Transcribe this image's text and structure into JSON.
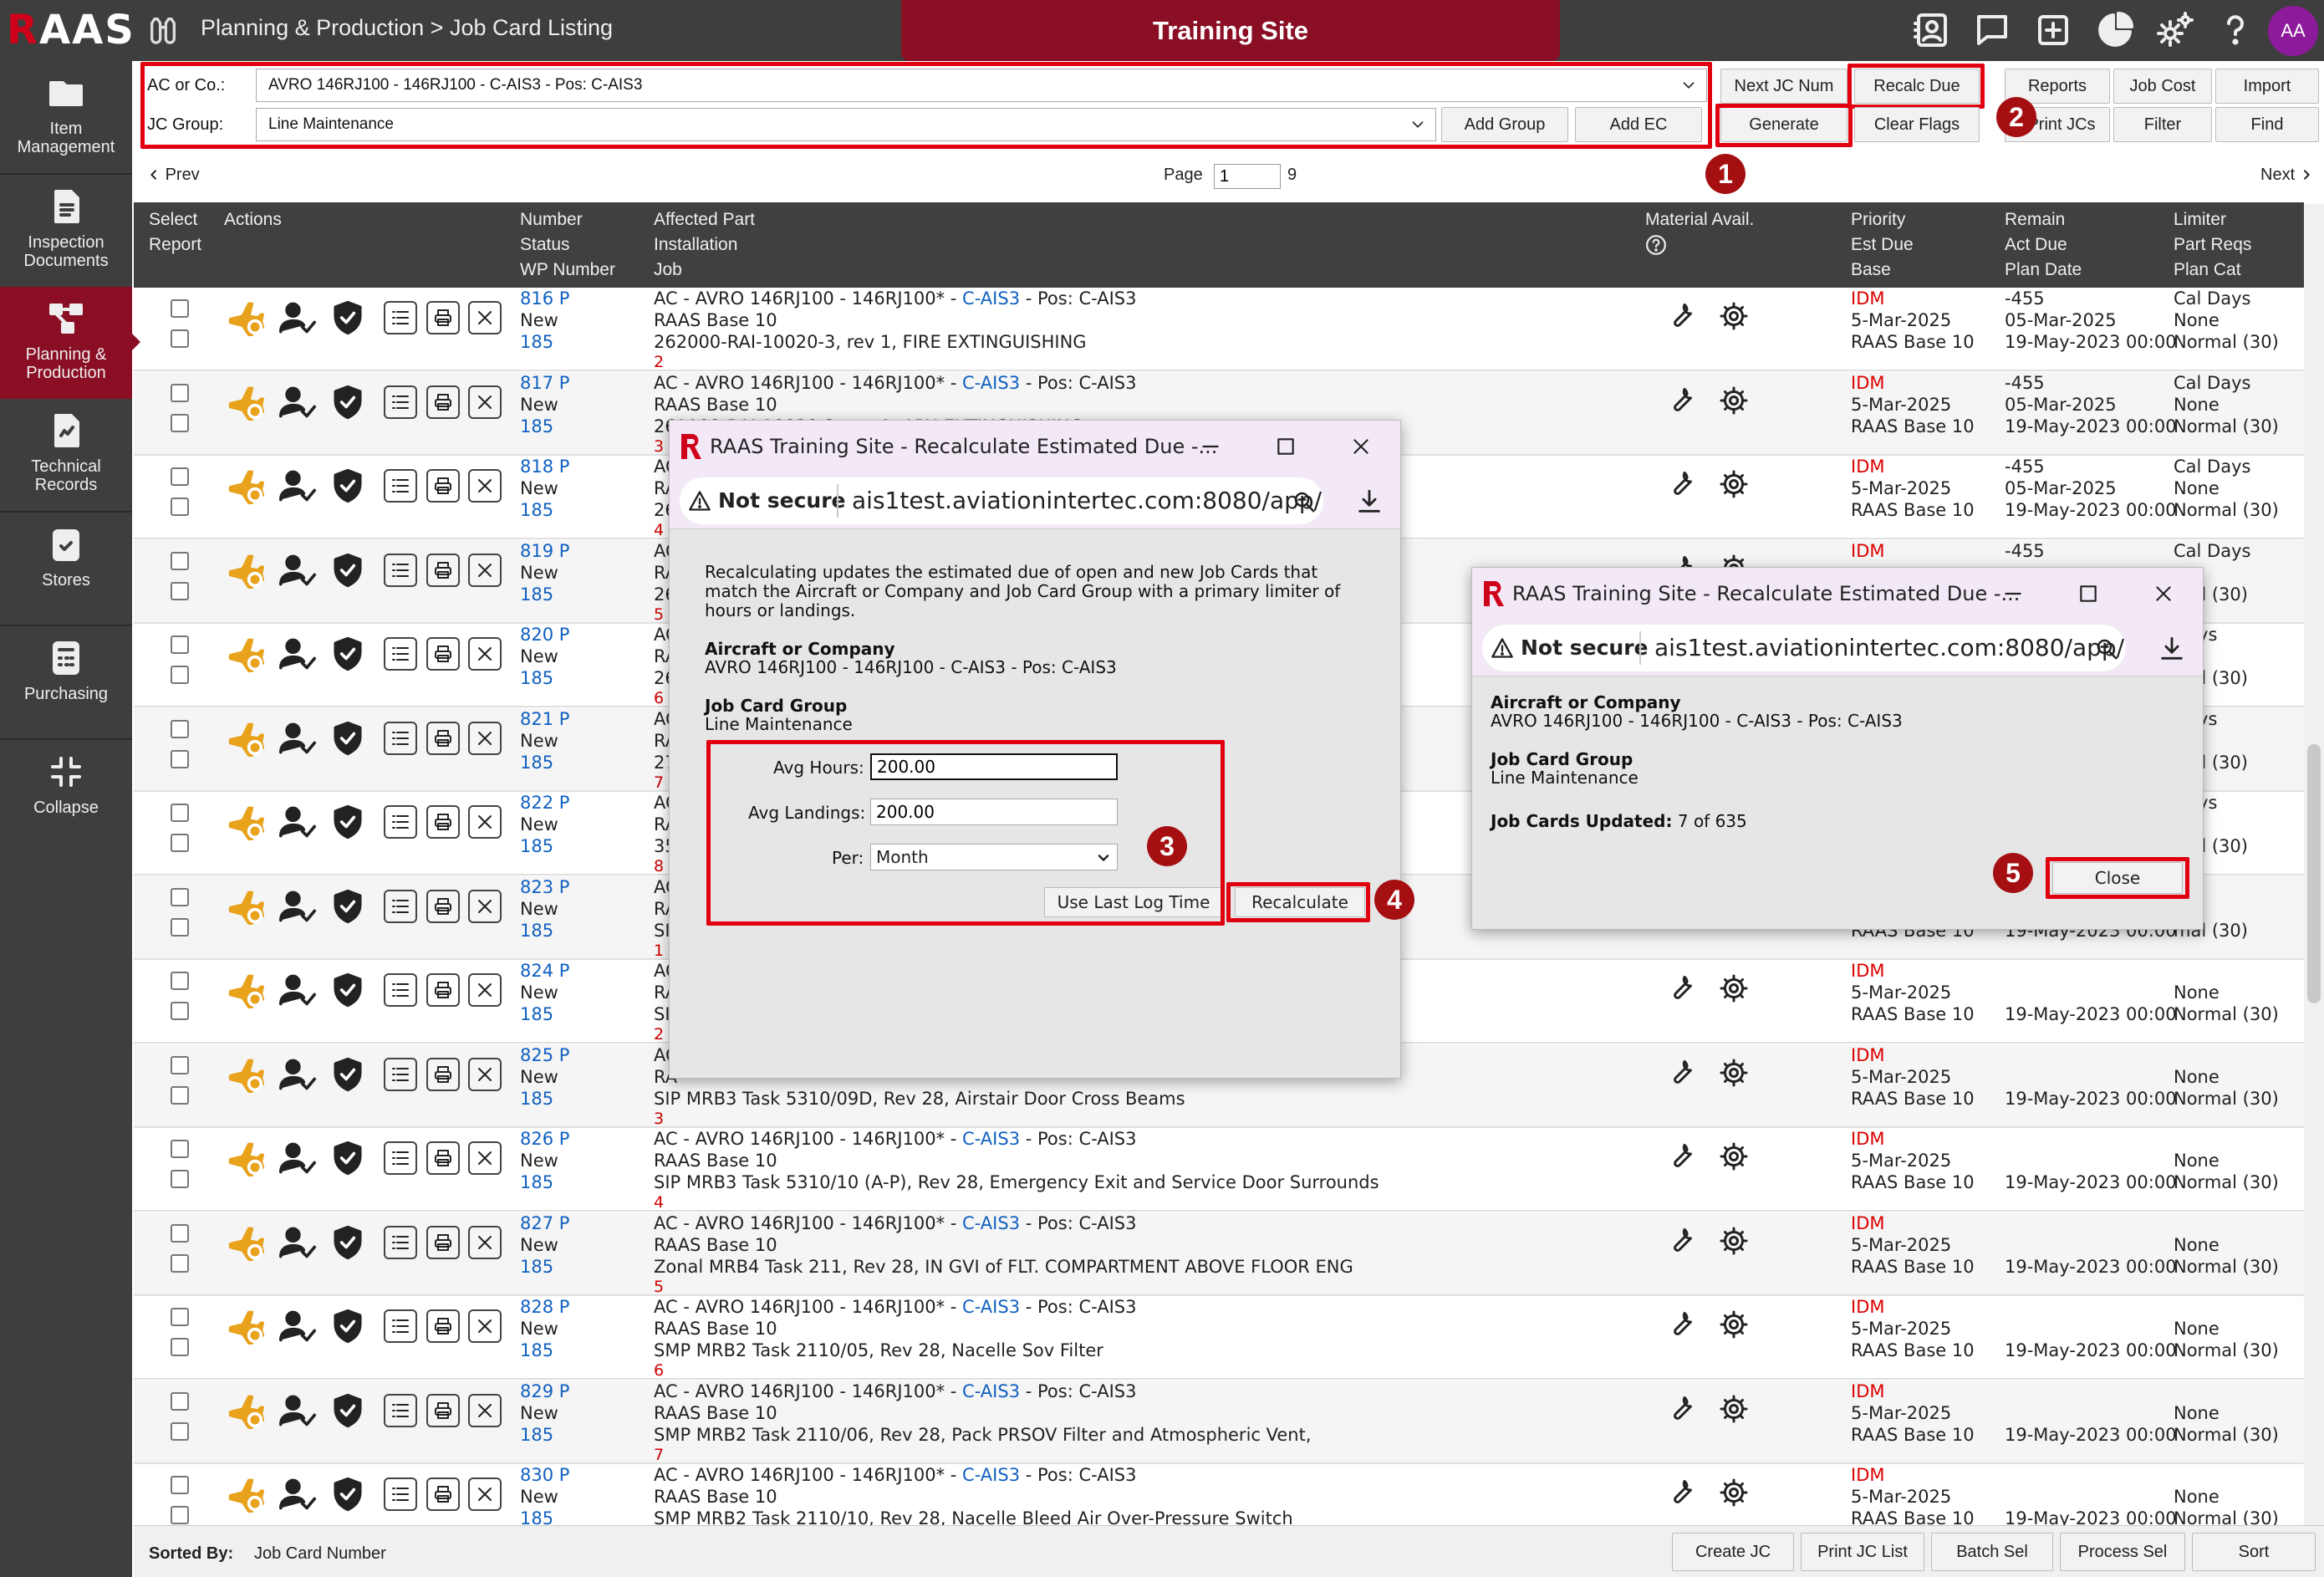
{
  "app": {
    "logo_r": "R",
    "logo_rest": "AAS",
    "breadcrumb": "Planning & Production > Job Card Listing",
    "site_label": "Training Site",
    "user_initials": "AA"
  },
  "toolbar_icons": [
    "contact-card-icon",
    "chat-icon",
    "add-square-icon",
    "pie-chart-icon",
    "gears-icon",
    "help-icon"
  ],
  "sidebar": {
    "items": [
      {
        "label1": "Item",
        "label2": "Management"
      },
      {
        "label1": "Inspection",
        "label2": "Documents"
      },
      {
        "label1": "Planning &",
        "label2": "Production"
      },
      {
        "label1": "Technical",
        "label2": "Records"
      },
      {
        "label1": "Stores",
        "label2": ""
      },
      {
        "label1": "Purchasing",
        "label2": ""
      },
      {
        "label1": "Collapse",
        "label2": ""
      }
    ]
  },
  "filters": {
    "ac_label": "AC or Co.:",
    "ac_value": "AVRO 146RJ100 - 146RJ100 - C-AIS3 - Pos: C-AIS3",
    "jc_label": "JC Group:",
    "jc_value": "Line Maintenance"
  },
  "buttons": {
    "add_group": "Add Group",
    "add_ec": "Add EC",
    "next_jc_num": "Next JC Num",
    "recalc_due": "Recalc Due",
    "generate": "Generate",
    "clear_flags": "Clear Flags",
    "reports": "Reports",
    "job_cost": "Job Cost",
    "import": "Import",
    "print_jcs": "Print JCs",
    "filter": "Filter",
    "find": "Find"
  },
  "pager": {
    "prev": "Prev",
    "next": "Next",
    "page_label": "Page",
    "page_value": "1",
    "total": "9"
  },
  "columns": {
    "select": "Select",
    "report": "Report",
    "actions": "Actions",
    "number": "Number",
    "status": "Status",
    "wp_number": "WP Number",
    "affected_part": "Affected Part",
    "installation": "Installation",
    "job": "Job",
    "material": "Material Avail.",
    "priority": "Priority",
    "est_due": "Est Due",
    "base": "Base",
    "remain": "Remain",
    "act_due": "Act Due",
    "plan_date": "Plan Date",
    "limiter": "Limiter",
    "part_reqs": "Part Reqs",
    "plan_cat": "Plan Cat"
  },
  "rows": [
    {
      "number": "816 P",
      "status": "New",
      "wp": "185",
      "part_prefix": "AC - AVRO 146RJ100 - 146RJ100* - ",
      "part_link": "C-AIS3",
      "part_suffix": " - Pos: C-AIS3",
      "install": "RAAS Base 10",
      "job": "262000-RAI-10020-3, rev 1, FIRE EXTINGUISHING",
      "seq": "2",
      "priority": "IDM",
      "est_due": "5-Mar-2025",
      "base": "RAAS Base 10",
      "remain": "-455",
      "act_due": "05-Mar-2025",
      "plan_date": "19-May-2023 00:00",
      "limiter": "Cal Days",
      "part_reqs": "None",
      "plan_cat": "Normal (30)"
    },
    {
      "number": "817 P",
      "status": "New",
      "wp": "185",
      "part_prefix": "AC - AVRO 146RJ100 - 146RJ100* - ",
      "part_link": "C-AIS3",
      "part_suffix": " - Pos: C-AIS3",
      "install": "RAAS Base 10",
      "job": "261100-RAI-10020-3, rev 1, APU EXTINGUISHING",
      "seq": "3",
      "priority": "IDM",
      "est_due": "5-Mar-2025",
      "base": "RAAS Base 10",
      "remain": "-455",
      "act_due": "05-Mar-2025",
      "plan_date": "19-May-2023 00:00",
      "limiter": "Cal Days",
      "part_reqs": "None",
      "plan_cat": "Normal (30)"
    },
    {
      "number": "818 P",
      "status": "New",
      "wp": "185",
      "part_prefix": "AC",
      "part_link": "",
      "part_suffix": "",
      "install": "RA",
      "job": "26",
      "seq": "4",
      "priority": "IDM",
      "est_due": "5-Mar-2025",
      "base": "RAAS Base 10",
      "remain": "-455",
      "act_due": "05-Mar-2025",
      "plan_date": "19-May-2023 00:00",
      "limiter": "Cal Days",
      "part_reqs": "None",
      "plan_cat": "Normal (30)"
    },
    {
      "number": "819 P",
      "status": "New",
      "wp": "185",
      "part_prefix": "AC",
      "part_link": "",
      "part_suffix": "",
      "install": "RA",
      "job": "26",
      "seq": "5",
      "priority": "IDM",
      "est_due": "",
      "base": "",
      "remain": "-455",
      "act_due": "",
      "plan_date": "",
      "limiter": "Cal Days",
      "part_reqs": "",
      "plan_cat": "mal (30)"
    },
    {
      "number": "820 P",
      "status": "New",
      "wp": "185",
      "part_prefix": "AC",
      "part_link": "",
      "part_suffix": "",
      "install": "RA",
      "job": "26",
      "seq": "6",
      "priority": "",
      "est_due": "",
      "base": "",
      "remain": "",
      "act_due": "",
      "plan_date": "",
      "limiter": "Days",
      "part_reqs": "e",
      "plan_cat": "mal (30)"
    },
    {
      "number": "821 P",
      "status": "New",
      "wp": "185",
      "part_prefix": "AC",
      "part_link": "",
      "part_suffix": "",
      "install": "RA",
      "job": "27",
      "seq": "7",
      "priority": "",
      "est_due": "",
      "base": "",
      "remain": "",
      "act_due": "",
      "plan_date": "",
      "limiter": "Days",
      "part_reqs": "e",
      "plan_cat": "mal (30)"
    },
    {
      "number": "822 P",
      "status": "New",
      "wp": "185",
      "part_prefix": "AC",
      "part_link": "",
      "part_suffix": "",
      "install": "RA",
      "job": "35",
      "seq": "8",
      "priority": "",
      "est_due": "",
      "base": "",
      "remain": "",
      "act_due": "",
      "plan_date": "",
      "limiter": "Days",
      "part_reqs": "e",
      "plan_cat": "mal (30)"
    },
    {
      "number": "823 P",
      "status": "New",
      "wp": "185",
      "part_prefix": "AC",
      "part_link": "",
      "part_suffix": "",
      "install": "RA",
      "job": "SI",
      "seq": "1",
      "priority": "",
      "est_due": "",
      "base": "RAAS Base 10",
      "remain": "",
      "act_due": "",
      "plan_date": "19-May-2023 00:00",
      "limiter": "",
      "part_reqs": "e",
      "plan_cat": "mal (30)"
    },
    {
      "number": "824 P",
      "status": "New",
      "wp": "185",
      "part_prefix": "AC",
      "part_link": "",
      "part_suffix": "",
      "install": "RA",
      "job": "SI",
      "seq": "2",
      "priority": "IDM",
      "est_due": "5-Mar-2025",
      "base": "RAAS Base 10",
      "remain": "",
      "act_due": "",
      "plan_date": "19-May-2023 00:00",
      "limiter": "",
      "part_reqs": "None",
      "plan_cat": "Normal (30)"
    },
    {
      "number": "825 P",
      "status": "New",
      "wp": "185",
      "part_prefix": "AC",
      "part_link": "",
      "part_suffix": "",
      "install": "RA",
      "job": "SIP MRB3 Task 5310/09D, Rev 28, Airstair Door Cross Beams",
      "seq": "3",
      "priority": "IDM",
      "est_due": "5-Mar-2025",
      "base": "RAAS Base 10",
      "remain": "",
      "act_due": "",
      "plan_date": "19-May-2023 00:00",
      "limiter": "",
      "part_reqs": "None",
      "plan_cat": "Normal (30)"
    },
    {
      "number": "826 P",
      "status": "New",
      "wp": "185",
      "part_prefix": "AC - AVRO 146RJ100 - 146RJ100* - ",
      "part_link": "C-AIS3",
      "part_suffix": " - Pos: C-AIS3",
      "install": "RAAS Base 10",
      "job": "SIP MRB3 Task 5310/10 (A-P), Rev 28, Emergency Exit and Service Door Surrounds",
      "seq": "4",
      "priority": "IDM",
      "est_due": "5-Mar-2025",
      "base": "RAAS Base 10",
      "remain": "",
      "act_due": "",
      "plan_date": "19-May-2023 00:00",
      "limiter": "",
      "part_reqs": "None",
      "plan_cat": "Normal (30)"
    },
    {
      "number": "827 P",
      "status": "New",
      "wp": "185",
      "part_prefix": "AC - AVRO 146RJ100 - 146RJ100* - ",
      "part_link": "C-AIS3",
      "part_suffix": " - Pos: C-AIS3",
      "install": "RAAS Base 10",
      "job": "Zonal MRB4 Task 211, Rev 28, IN GVI of FLT. COMPARTMENT ABOVE FLOOR ENG",
      "seq": "5",
      "priority": "IDM",
      "est_due": "5-Mar-2025",
      "base": "RAAS Base 10",
      "remain": "",
      "act_due": "",
      "plan_date": "19-May-2023 00:00",
      "limiter": "",
      "part_reqs": "None",
      "plan_cat": "Normal (30)"
    },
    {
      "number": "828 P",
      "status": "New",
      "wp": "185",
      "part_prefix": "AC - AVRO 146RJ100 - 146RJ100* - ",
      "part_link": "C-AIS3",
      "part_suffix": " - Pos: C-AIS3",
      "install": "RAAS Base 10",
      "job": "SMP MRB2 Task 2110/05, Rev 28, Nacelle Sov Filter",
      "seq": "6",
      "priority": "IDM",
      "est_due": "5-Mar-2025",
      "base": "RAAS Base 10",
      "remain": "",
      "act_due": "",
      "plan_date": "19-May-2023 00:00",
      "limiter": "",
      "part_reqs": "None",
      "plan_cat": "Normal (30)"
    },
    {
      "number": "829 P",
      "status": "New",
      "wp": "185",
      "part_prefix": "AC - AVRO 146RJ100 - 146RJ100* - ",
      "part_link": "C-AIS3",
      "part_suffix": " - Pos: C-AIS3",
      "install": "RAAS Base 10",
      "job": "SMP MRB2 Task 2110/06, Rev 28, Pack PRSOV Filter and Atmospheric Vent,",
      "seq": "7",
      "priority": "IDM",
      "est_due": "5-Mar-2025",
      "base": "RAAS Base 10",
      "remain": "",
      "act_due": "",
      "plan_date": "19-May-2023 00:00",
      "limiter": "",
      "part_reqs": "None",
      "plan_cat": "Normal (30)"
    },
    {
      "number": "830 P",
      "status": "New",
      "wp": "185",
      "part_prefix": "AC - AVRO 146RJ100 - 146RJ100* - ",
      "part_link": "C-AIS3",
      "part_suffix": " - Pos: C-AIS3",
      "install": "RAAS Base 10",
      "job": "SMP MRB2 Task 2110/10, Rev 28, Nacelle Bleed Air Over-Pressure Switch",
      "seq": "",
      "priority": "IDM",
      "est_due": "5-Mar-2025",
      "base": "RAAS Base 10",
      "remain": "",
      "act_due": "",
      "plan_date": "19-May-2023 00:00",
      "limiter": "",
      "part_reqs": "None",
      "plan_cat": "Normal (30)"
    }
  ],
  "footer": {
    "sorted_label": "Sorted By:",
    "sorted_value": "Job Card Number",
    "create_jc": "Create JC",
    "print_jc_list": "Print JC List",
    "batch_sel": "Batch Sel",
    "process_sel": "Process Sel",
    "sort": "Sort"
  },
  "dialog1": {
    "title": "RAAS Training Site - Recalculate Estimated Due -...",
    "not_secure": "Not secure",
    "url": "ais1test.aviationintertec.com:8080/app/...",
    "intro": "Recalculating updates the estimated due of open and new Job Cards that match the Aircraft or Company and Job Card Group with a primary limiter of hours or landings.",
    "ac_heading": "Aircraft or Company",
    "ac_value": "AVRO 146RJ100 - 146RJ100 - C-AIS3 - Pos: C-AIS3",
    "jc_heading": "Job Card Group",
    "jc_value": "Line Maintenance",
    "avg_hours_label": "Avg Hours:",
    "avg_hours_value": "200.00",
    "avg_landings_label": "Avg Landings:",
    "avg_landings_value": "200.00",
    "per_label": "Per:",
    "per_value": "Month",
    "use_last_log": "Use Last Log Time",
    "recalculate": "Recalculate"
  },
  "dialog2": {
    "title": "RAAS Training Site - Recalculate Estimated Due -...",
    "not_secure": "Not secure",
    "url": "ais1test.aviationintertec.com:8080/app/...",
    "ac_heading": "Aircraft or Company",
    "ac_value": "AVRO 146RJ100 - 146RJ100 - C-AIS3 - Pos: C-AIS3",
    "jc_heading": "Job Card Group",
    "jc_value": "Line Maintenance",
    "updated_label": "Job Cards Updated:",
    "updated_value": "7 of 635",
    "close": "Close"
  },
  "callouts": [
    "1",
    "2",
    "3",
    "4",
    "5"
  ],
  "colors": {
    "accent": "#8a0e24",
    "highlight": "#e00010",
    "callout": "#a50f12",
    "link": "#1060c0"
  }
}
